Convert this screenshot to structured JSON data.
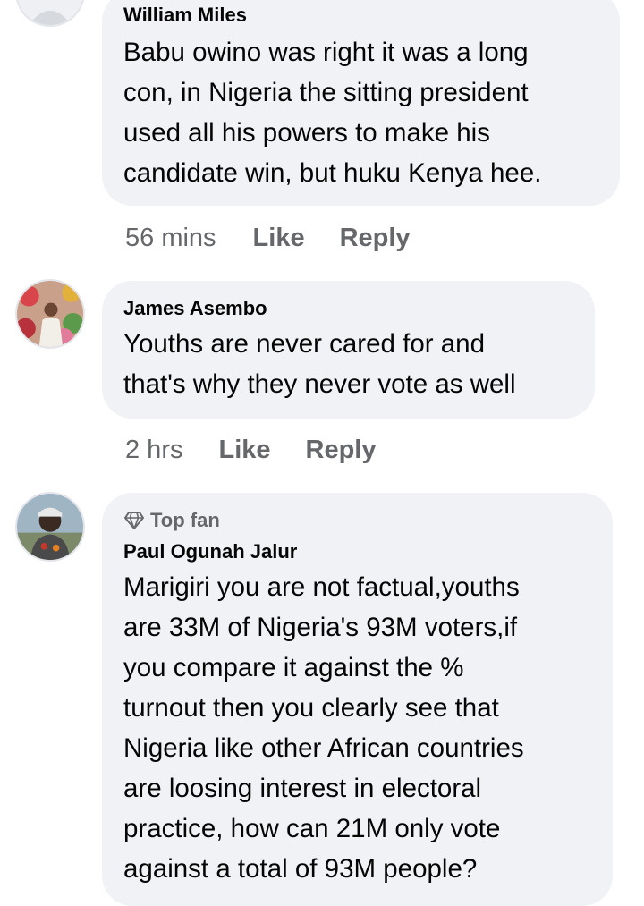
{
  "comments": [
    {
      "author": "William Miles",
      "text": "Babu owino was right it was a long\ncon, in Nigeria the sitting president\nused all his powers to make his\ncandidate win, but huku Kenya hee.",
      "time": "56 mins",
      "like": "Like",
      "reply": "Reply"
    },
    {
      "author": "James Asembo",
      "text": "Youths are never cared for and\nthat's why they never vote as well",
      "time": "2 hrs",
      "like": "Like",
      "reply": "Reply"
    },
    {
      "badge": "Top fan",
      "badge_icon": "diamond-icon",
      "author": "Paul Ogunah Jalur",
      "text": "Marigiri you are not factual,youths\nare 33M of Nigeria's 93M voters,if\nyou compare it against the %\nturnout then you clearly see that\nNigeria like other African countries\nare loosing interest in electoral\npractice, how can 21M only vote\nagainst a total of 93M people?"
    }
  ],
  "colors": {
    "bubble_bg": "#f0f2f5",
    "secondary_text": "#65676b",
    "primary_text": "#050505"
  }
}
